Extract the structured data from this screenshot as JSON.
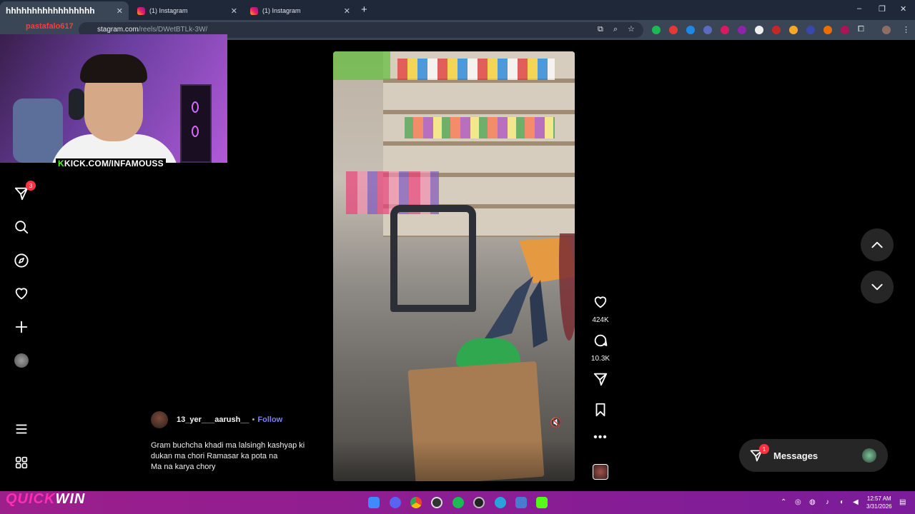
{
  "browser": {
    "tabs": [
      {
        "title": "hhhhhhhhhhhhhhhhh",
        "active": true
      },
      {
        "title": "(1) Instagram",
        "active": false
      },
      {
        "title": "(1) Instagram",
        "active": false
      }
    ],
    "new_tab": "+",
    "window_controls": [
      "–",
      "❐",
      "✕"
    ],
    "url_host": "stagram.com",
    "url_path": "/reels/DWetBTLk-3W/"
  },
  "overlay": {
    "streamer_name": "pastafalo617",
    "kick_logo": "K",
    "kick_url": "KICK.COM/INFAMOUSS",
    "sponsor_part1": "QUICK",
    "sponsor_part2": "WIN"
  },
  "sidebar": {
    "notifications_badge": "3",
    "icons": [
      "send-icon",
      "search-icon",
      "explore-icon",
      "heart-icon",
      "create-icon",
      "profile-avatar",
      "menu-icon",
      "more-icon"
    ]
  },
  "reel": {
    "likes": "424K",
    "comments": "10.3K",
    "author": "13_yer___aarush__",
    "separator": "•",
    "follow_label": "Follow",
    "caption_lines": [
      "Gram buchcha khadi ma lalsingh kashyap ki",
      "dukan ma chori Ramasar ka pota na",
      "Ma na karya chory"
    ]
  },
  "messages": {
    "label": "Messages",
    "badge": "1"
  },
  "taskbar": {
    "time": "12:57 AM",
    "date": "3/31/2026"
  },
  "colors": {
    "accent_follow": "#7d7dff",
    "badge_red": "#ff3040",
    "kick_green": "#53fc18"
  }
}
